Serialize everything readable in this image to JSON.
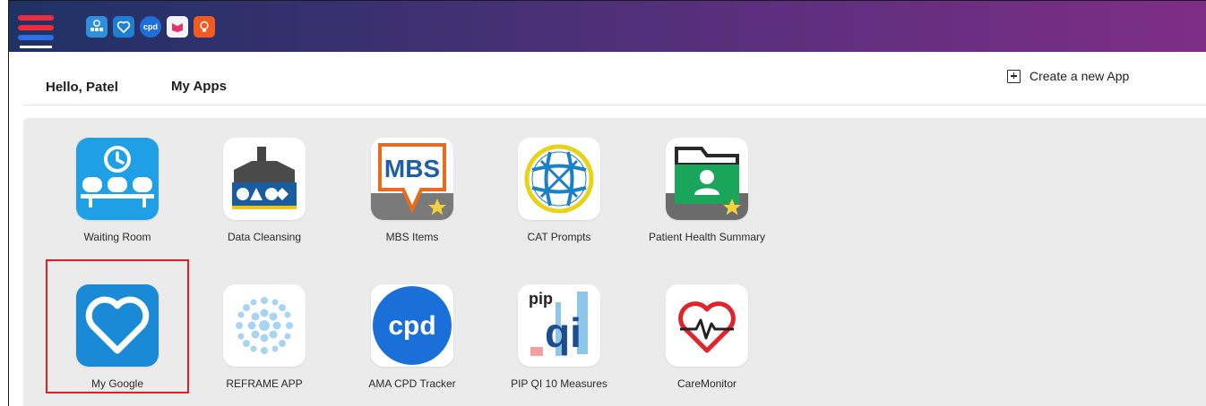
{
  "colors": {
    "accent_red": "#e02020",
    "topbar_start": "#1e3264",
    "topbar_end": "#7e2e86",
    "tile_blue": "#1a8ad6"
  },
  "topbar": {
    "quick_icons": [
      "waiting-room-icon",
      "heart-icon",
      "cpd-icon",
      "reframe-icon",
      "idea-icon"
    ],
    "cpd_text": "cpd"
  },
  "header": {
    "greeting": "Hello, Patel",
    "my_apps_label": "My Apps",
    "create_label": "Create a new App"
  },
  "apps": [
    {
      "label": "Waiting Room",
      "icon": "waiting-room-icon"
    },
    {
      "label": "Data Cleansing",
      "icon": "data-cleansing-icon"
    },
    {
      "label": "MBS Items",
      "icon": "mbs-icon",
      "icon_text": "MBS"
    },
    {
      "label": "CAT Prompts",
      "icon": "cat-prompts-icon"
    },
    {
      "label": "Patient Health Summary",
      "icon": "folder-user-icon"
    },
    {
      "label": "My Google",
      "icon": "heart-icon",
      "selected": true
    },
    {
      "label": "REFRAME APP",
      "icon": "reframe-icon"
    },
    {
      "label": "AMA CPD Tracker",
      "icon": "cpd-icon",
      "icon_text": "cpd"
    },
    {
      "label": "PIP QI 10 Measures",
      "icon": "pipqi-icon",
      "icon_text_top": "pip",
      "icon_text_main": "qi"
    },
    {
      "label": "CareMonitor",
      "icon": "heartbeat-icon"
    }
  ]
}
